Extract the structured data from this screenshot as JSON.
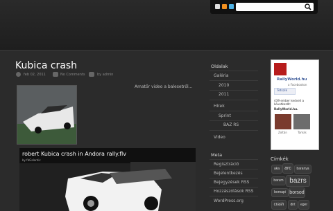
{
  "post": {
    "title": "Kubica crash",
    "date": "feb 02, 2011",
    "comments": "No Comments",
    "author": "by admin",
    "caption": "Amatőr video a balesetről..."
  },
  "video": {
    "title": "robert Kubica crash in Andora rally.flv",
    "uploader": "by fbGalantic"
  },
  "sidebar": {
    "pages_heading": "Oldalak",
    "pages": [
      "Galéria",
      "2010",
      "2011",
      "Hírek",
      "Sprint",
      "BAZ RS",
      "Video"
    ],
    "meta_heading": "Meta",
    "meta": [
      "Regisztráció",
      "Bejelentkezés",
      "Bejegyzések RSS",
      "Hozzászólások RSS",
      "WordPress.org"
    ]
  },
  "facebook": {
    "page_name": "RallyWorld.hu",
    "page_suffix": "a Facebookon",
    "like_label": "Tetszik",
    "followers_text": "439 ember kedveli a következőt:",
    "followers_name": "RallyWorld.hu.",
    "friends": [
      "Zoltán",
      "Tamás"
    ]
  },
  "tags": {
    "heading": "Címkék",
    "items": [
      "aka",
      "arc",
      "baranya",
      "barum",
      "bazrs",
      "bornapi",
      "borsod",
      "crash",
      "dirt",
      "eger"
    ]
  }
}
